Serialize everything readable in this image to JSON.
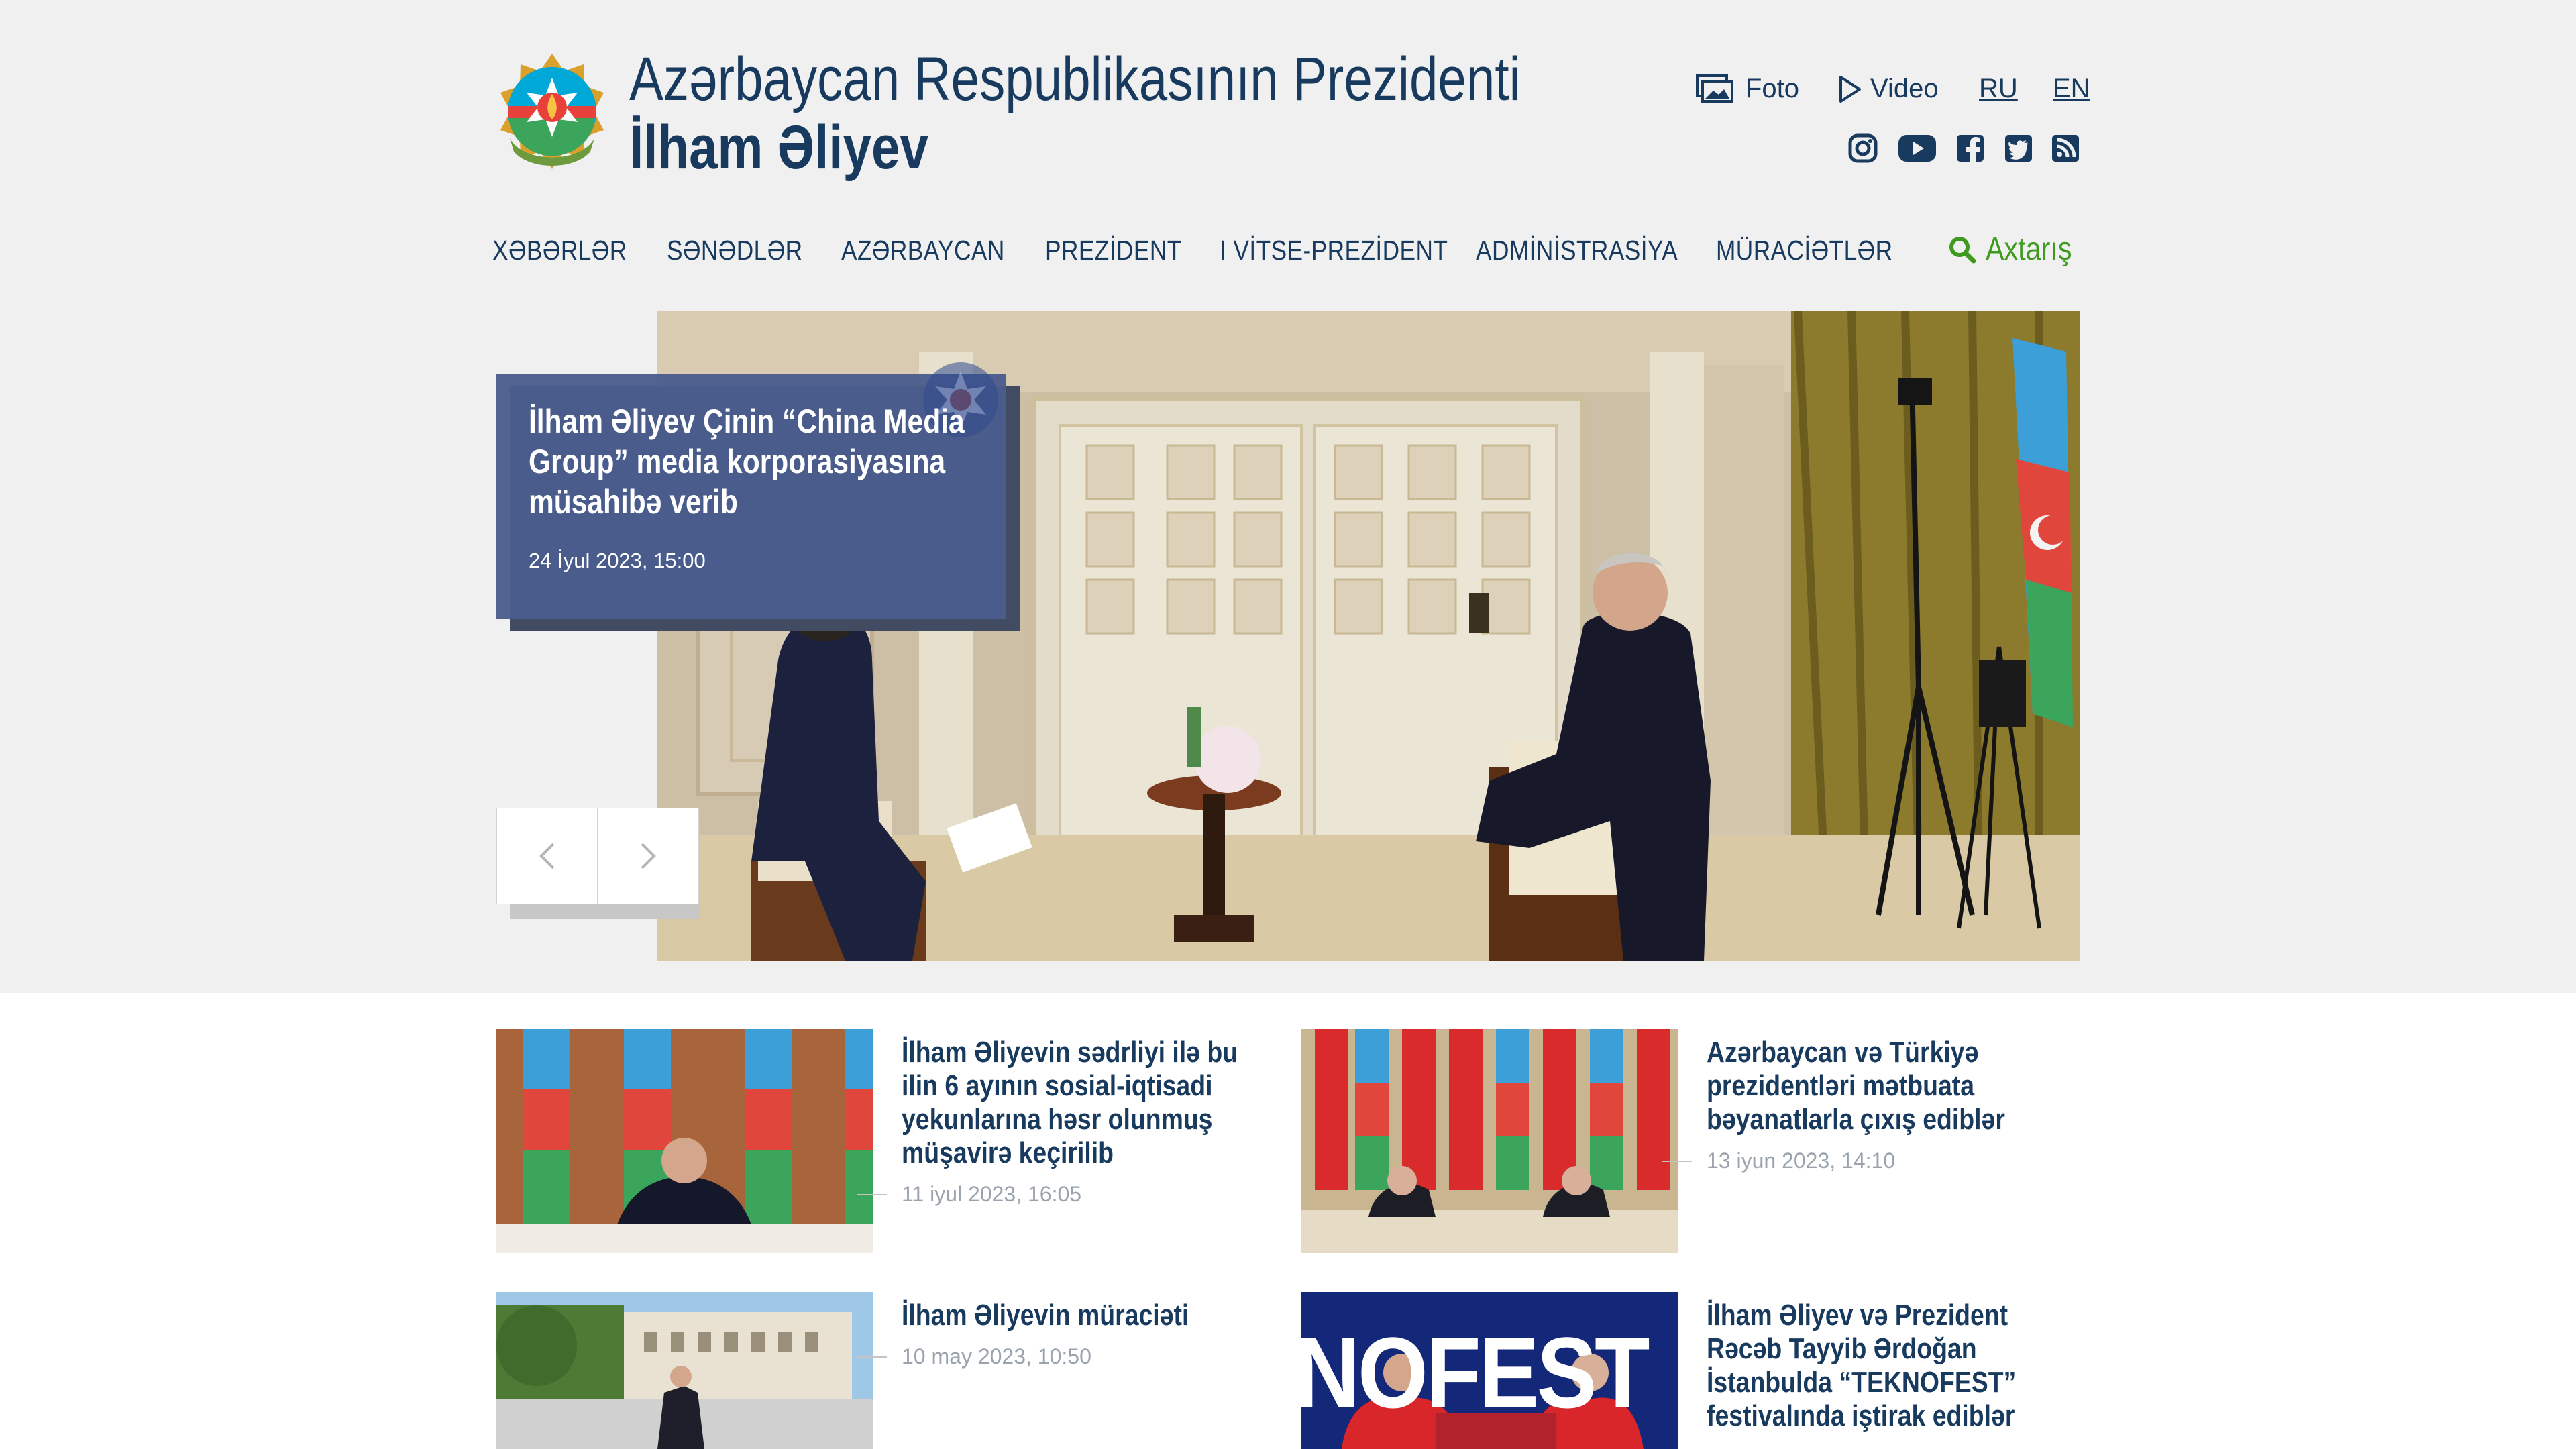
{
  "header": {
    "title_line1": "Azərbaycan Respublikasının Prezidenti",
    "title_line2": "İlham Əliyev",
    "links": {
      "photo": "Foto",
      "video": "Video",
      "ru": "RU",
      "en": "EN"
    },
    "social_icons": [
      "instagram-icon",
      "youtube-icon",
      "facebook-icon",
      "twitter-icon",
      "rss-icon"
    ]
  },
  "menu": {
    "items": [
      "XƏBƏRLƏR",
      "SƏNƏDLƏR",
      "AZƏRBAYCAN",
      "PREZİDENT",
      "I VİTSE-PREZİDENT",
      "ADMİNİSTRASİYA",
      "MÜRACİƏTLƏR"
    ],
    "search_label": "Axtarış"
  },
  "hero": {
    "title": "İlham Əliyev Çinin “China Media Group” media korporasiyasına müsahibə verib",
    "date": "24 İyul 2023, 15:00"
  },
  "news": [
    {
      "title": "İlham Əliyevin sədrliyi ilə bu ilin 6 ayının sosial-iqtisadi yekunlarına həsr olunmuş müşavirə keçirilib",
      "date": "11 iyul 2023, 16:05"
    },
    {
      "title": "Azərbaycan və Türkiyə prezidentləri mətbuata bəyanatlarla çıxış ediblər",
      "date": "13 iyun 2023, 14:10"
    },
    {
      "title": "İlham Əliyevin müraciəti",
      "date": "10 may 2023, 10:50"
    },
    {
      "title": "İlham Əliyev və Prezident Rəcəb Tayyib Ərdoğan İstanbulda “TEKNOFEST” festivalında iştirak ediblər",
      "date": ""
    },
    {
      "thumb_text": "NOFEST"
    }
  ],
  "colors": {
    "navy": "#173a5e",
    "accent_green": "#3f9a1f",
    "hero_card": "#4b5d8d",
    "date_gray": "#9aa3ad"
  }
}
